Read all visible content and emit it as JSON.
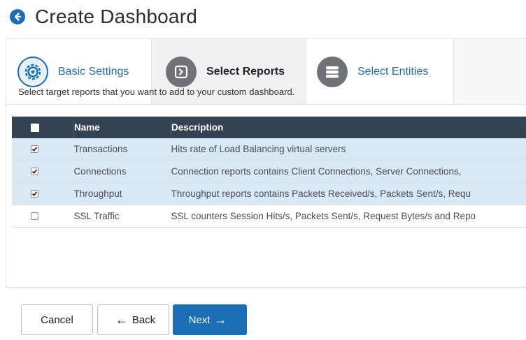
{
  "header": {
    "title": "Create Dashboard"
  },
  "wizard": {
    "steps": [
      {
        "label": "Basic Settings",
        "icon": "gear-icon",
        "active": false
      },
      {
        "label": "Select Reports",
        "icon": "report-arrow-icon",
        "active": true
      },
      {
        "label": "Select Entities",
        "icon": "server-stack-icon",
        "active": false
      }
    ],
    "instruction": "Select target reports that you want to add to your custom dashboard."
  },
  "table": {
    "columns": [
      "Name",
      "Description"
    ],
    "rows": [
      {
        "checked": true,
        "name": "Transactions",
        "description": "Hits rate of Load Balancing virtual servers"
      },
      {
        "checked": true,
        "name": "Connections",
        "description": "Connection reports contains Client Connections, Server Connections,"
      },
      {
        "checked": true,
        "name": "Throughput",
        "description": "Throughput reports contains Packets Received/s, Packets Sent/s, Requ"
      },
      {
        "checked": false,
        "name": "SSL Traffic",
        "description": "SSL counters Session Hits/s, Packets Sent/s, Request Bytes/s and Repo"
      }
    ]
  },
  "buttons": {
    "cancel": "Cancel",
    "back": "Back",
    "next": "Next"
  },
  "colors": {
    "accent": "#1b6eb4",
    "table_header": "#344253",
    "row_selected": "#d9e8f5"
  }
}
